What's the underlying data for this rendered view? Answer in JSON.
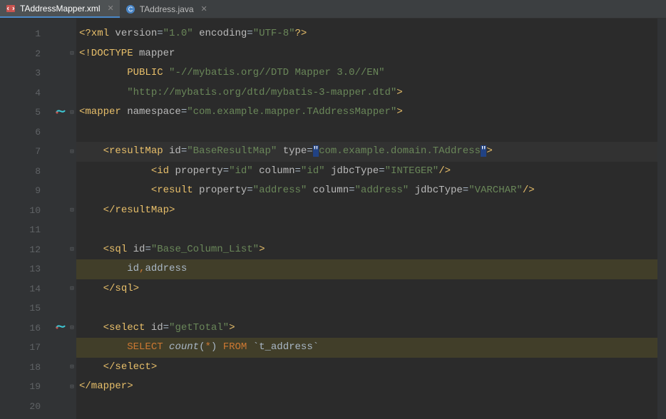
{
  "tabs": [
    {
      "label": "TAddressMapper.xml",
      "active": true
    },
    {
      "label": "TAddress.java",
      "active": false
    }
  ],
  "lines": {
    "l1": {
      "n": "1",
      "xml_decl": "<?xml",
      "ver_attr": "version",
      "ver_val": "\"1.0\"",
      "enc_attr": "encoding",
      "enc_val": "\"UTF-8\"",
      "close": "?>"
    },
    "l2": {
      "n": "2",
      "doctype": "<!DOCTYPE",
      "name": "mapper"
    },
    "l3": {
      "n": "3",
      "pub": "PUBLIC",
      "val": "\"-//mybatis.org//DTD Mapper 3.0//EN\""
    },
    "l4": {
      "n": "4",
      "val": "\"http://mybatis.org/dtd/mybatis-3-mapper.dtd\"",
      "close": ">"
    },
    "l5": {
      "n": "5",
      "open": "<mapper",
      "ns_attr": "namespace",
      "ns_val": "\"com.example.mapper.TAddressMapper\"",
      "close": ">"
    },
    "l6": {
      "n": "6"
    },
    "l7": {
      "n": "7",
      "open": "<resultMap",
      "id_attr": "id",
      "id_val": "\"BaseResultMap\"",
      "type_attr": "type",
      "type_val_q": "\"",
      "type_val": "com.example.domain.TAddress",
      "close": ">"
    },
    "l8": {
      "n": "8",
      "open": "<id",
      "p_attr": "property",
      "p_val": "\"id\"",
      "c_attr": "column",
      "c_val": "\"id\"",
      "j_attr": "jdbcType",
      "j_val": "\"INTEGER\"",
      "close": "/>"
    },
    "l9": {
      "n": "9",
      "open": "<result",
      "p_attr": "property",
      "p_val": "\"address\"",
      "c_attr": "column",
      "c_val": "\"address\"",
      "j_attr": "jdbcType",
      "j_val": "\"VARCHAR\"",
      "close": "/>"
    },
    "l10": {
      "n": "10",
      "close": "</resultMap>"
    },
    "l11": {
      "n": "11"
    },
    "l12": {
      "n": "12",
      "open": "<sql",
      "id_attr": "id",
      "id_val": "\"Base_Column_List\"",
      "close": ">"
    },
    "l13": {
      "n": "13",
      "c1": "id",
      "comma": ",",
      "c2": "address"
    },
    "l14": {
      "n": "14",
      "close": "</sql>"
    },
    "l15": {
      "n": "15"
    },
    "l16": {
      "n": "16",
      "open": "<select",
      "id_attr": "id",
      "id_val": "\"getTotal\"",
      "close": ">"
    },
    "l17": {
      "n": "17",
      "sel": "SELECT",
      "cnt": "count",
      "lp": "(",
      "star": "*",
      "rp": ")",
      "from": "FROM",
      "tbl": "`t_address`"
    },
    "l18": {
      "n": "18",
      "close": "</select>"
    },
    "l19": {
      "n": "19",
      "close": "</mapper>"
    },
    "l20": {
      "n": "20"
    }
  }
}
